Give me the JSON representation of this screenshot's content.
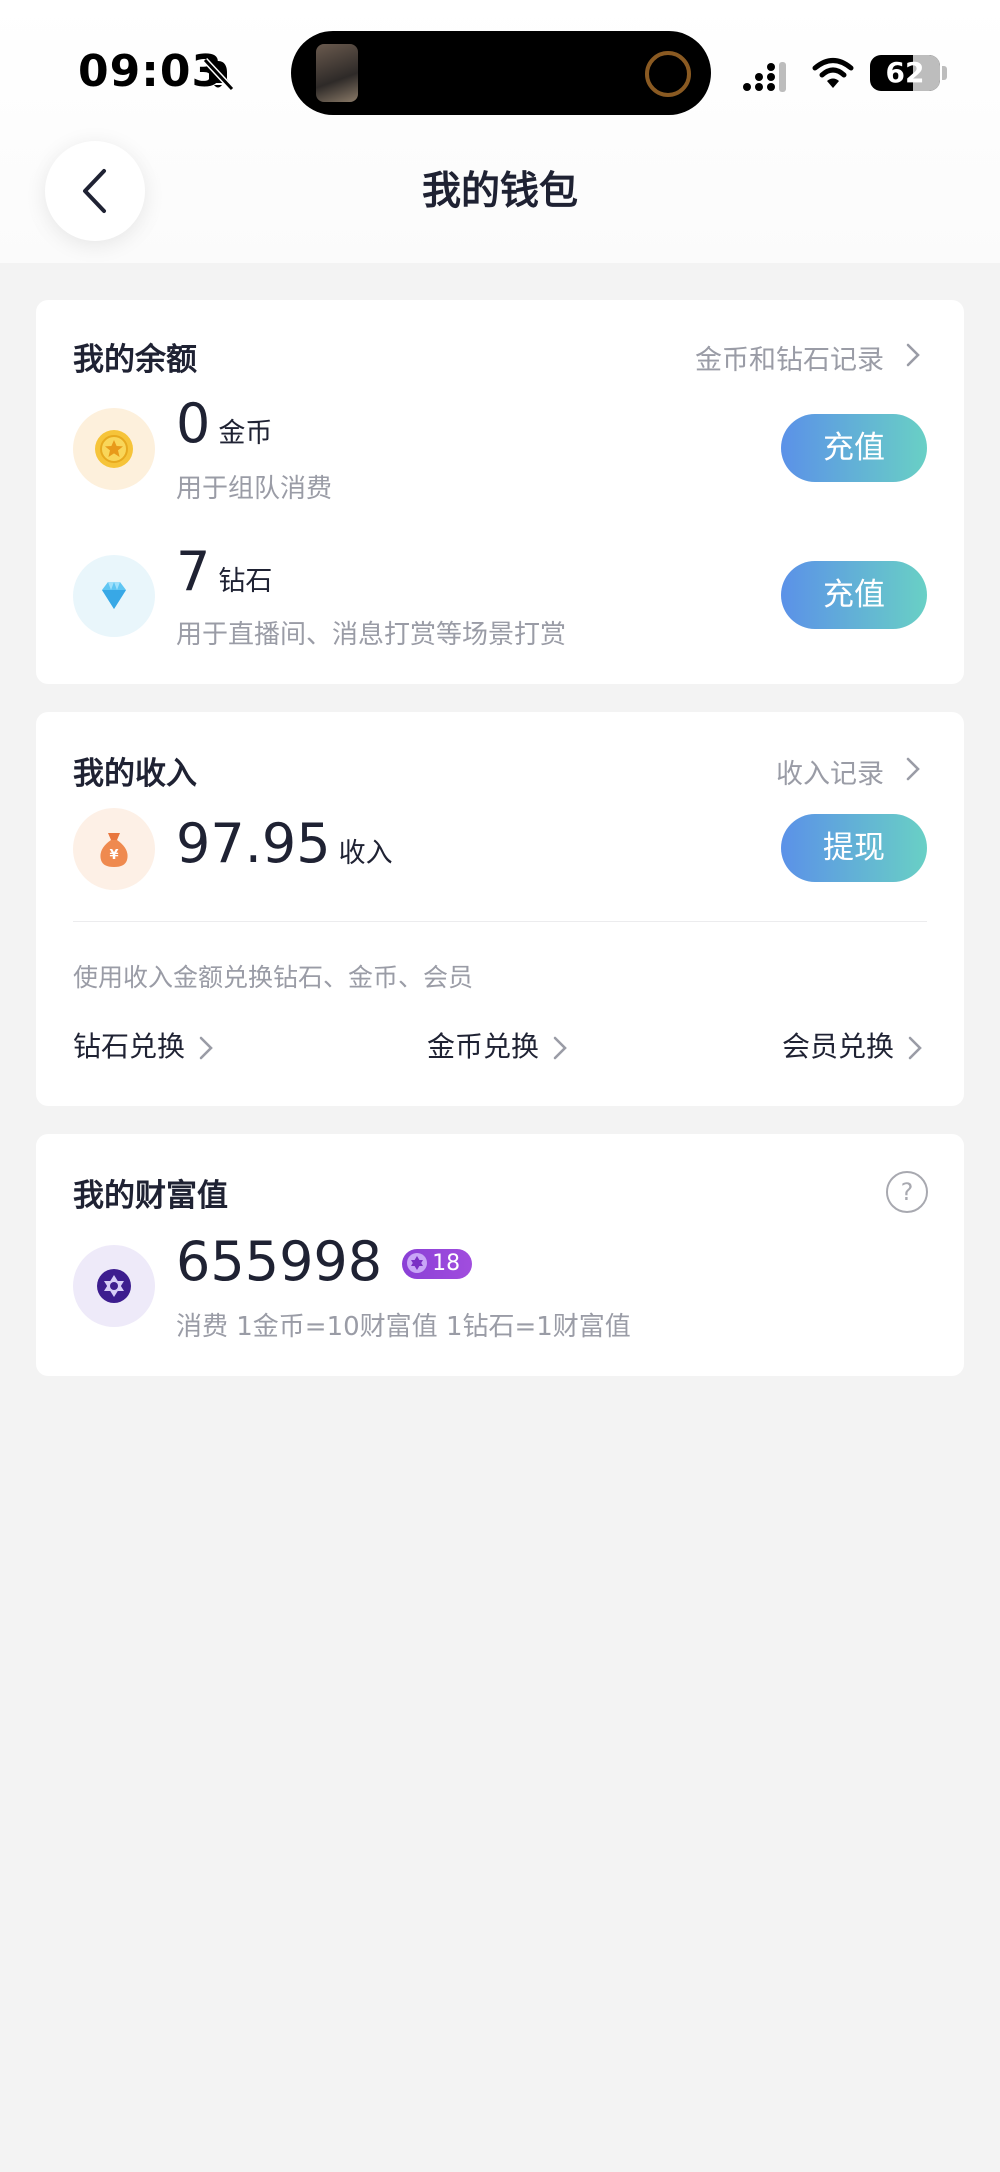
{
  "status_bar": {
    "time": "09:03",
    "battery": 62,
    "icons": [
      "bell-slash-icon",
      "signal-icon",
      "wifi-icon",
      "battery-icon"
    ]
  },
  "header": {
    "title": "我的钱包",
    "back_icon": "chevron-left-icon"
  },
  "balance": {
    "title": "我的余额",
    "record_link": "金币和钻石记录",
    "gold": {
      "icon": "gold-coin-icon",
      "amount": "0",
      "unit": "金币",
      "desc": "用于组队消费",
      "button": "充值"
    },
    "diamond": {
      "icon": "diamond-icon",
      "amount": "7",
      "unit": "钻石",
      "desc": "用于直播间、消息打赏等场景打赏",
      "button": "充值"
    }
  },
  "income": {
    "title": "我的收入",
    "record_link": "收入记录",
    "icon": "money-bag-icon",
    "amount": "97.95",
    "unit": "收入",
    "button": "提现",
    "exchange_hint": "使用收入金额兑换钻石、金币、会员",
    "exchanges": [
      "钻石兑换",
      "金币兑换",
      "会员兑换"
    ]
  },
  "wealth": {
    "title": "我的财富值",
    "icon": "wealth-star-icon",
    "amount": "655998",
    "level": "18",
    "desc": "消费 1金币=10财富值 1钻石=1财富值",
    "help_icon": "question-circle-icon"
  },
  "colors": {
    "background": "#f3f3f3",
    "text_primary": "#1f2233",
    "text_secondary": "#9a9ca6",
    "button_gradient_start": "#5b91e8",
    "button_gradient_end": "#69d0c5",
    "badge_purple": "#8a3fd6"
  }
}
